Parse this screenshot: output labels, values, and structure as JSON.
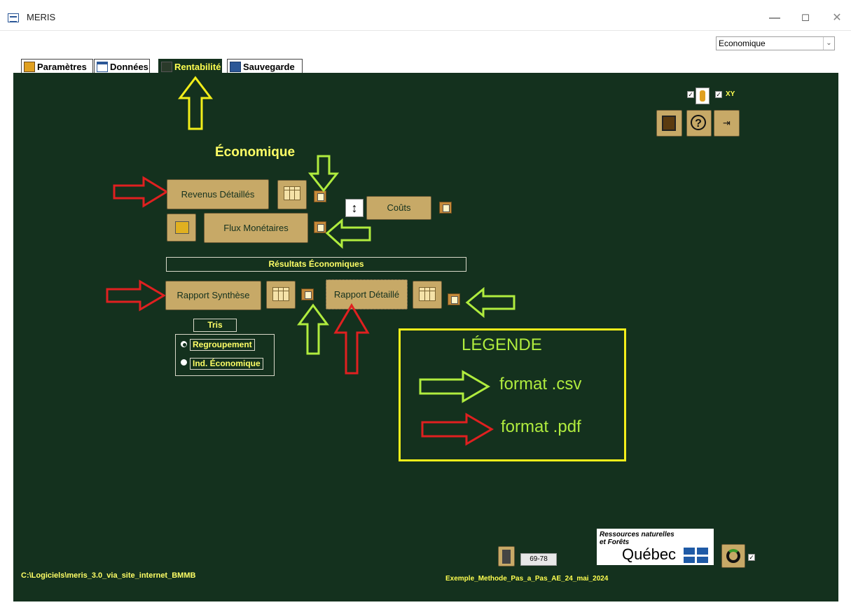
{
  "window": {
    "title": "MERIS",
    "min": "—",
    "max": "☐",
    "close": "✕"
  },
  "combo": {
    "value": "Economique",
    "arrow": "⌄"
  },
  "tabs": [
    {
      "label": "Paramètres"
    },
    {
      "label": "Données"
    },
    {
      "label": "Rentabilité"
    },
    {
      "label": "Sauvegarde"
    }
  ],
  "main": {
    "heading": "Économique",
    "buttons": {
      "revenus": "Revenus Détaillés",
      "couts": "Coûts",
      "flux": "Flux Monétaires",
      "rapport_synthese": "Rapport Synthèse",
      "rapport_detaille": "Rapport Détaillé"
    },
    "results_title": "Résultats Économiques",
    "tris": {
      "label": "Tris",
      "options": [
        "Regroupement",
        "Ind. Économique"
      ],
      "selected": "Regroupement"
    },
    "top_right": {
      "xy_label": "XY"
    },
    "legend": {
      "title": "LÉGENDE",
      "csv": "format .csv",
      "pdf": "format .pdf"
    },
    "footer": {
      "path": "C:\\Logiciels\\meris_3.0_via_site_internet_BMMB",
      "file": "Exemple_Methode_Pas_a_Pas_AE_24_mai_2024",
      "range": "69-78",
      "logo_line1": "Ressources naturelles",
      "logo_line2": "et Forêts",
      "logo_name": "Québec"
    }
  },
  "colors": {
    "panel": "#14311e",
    "button": "#c7a967",
    "csv_arrow": "#b0ec3e",
    "pdf_arrow": "#e02020",
    "tab_arrow": "#f2ee1a"
  }
}
